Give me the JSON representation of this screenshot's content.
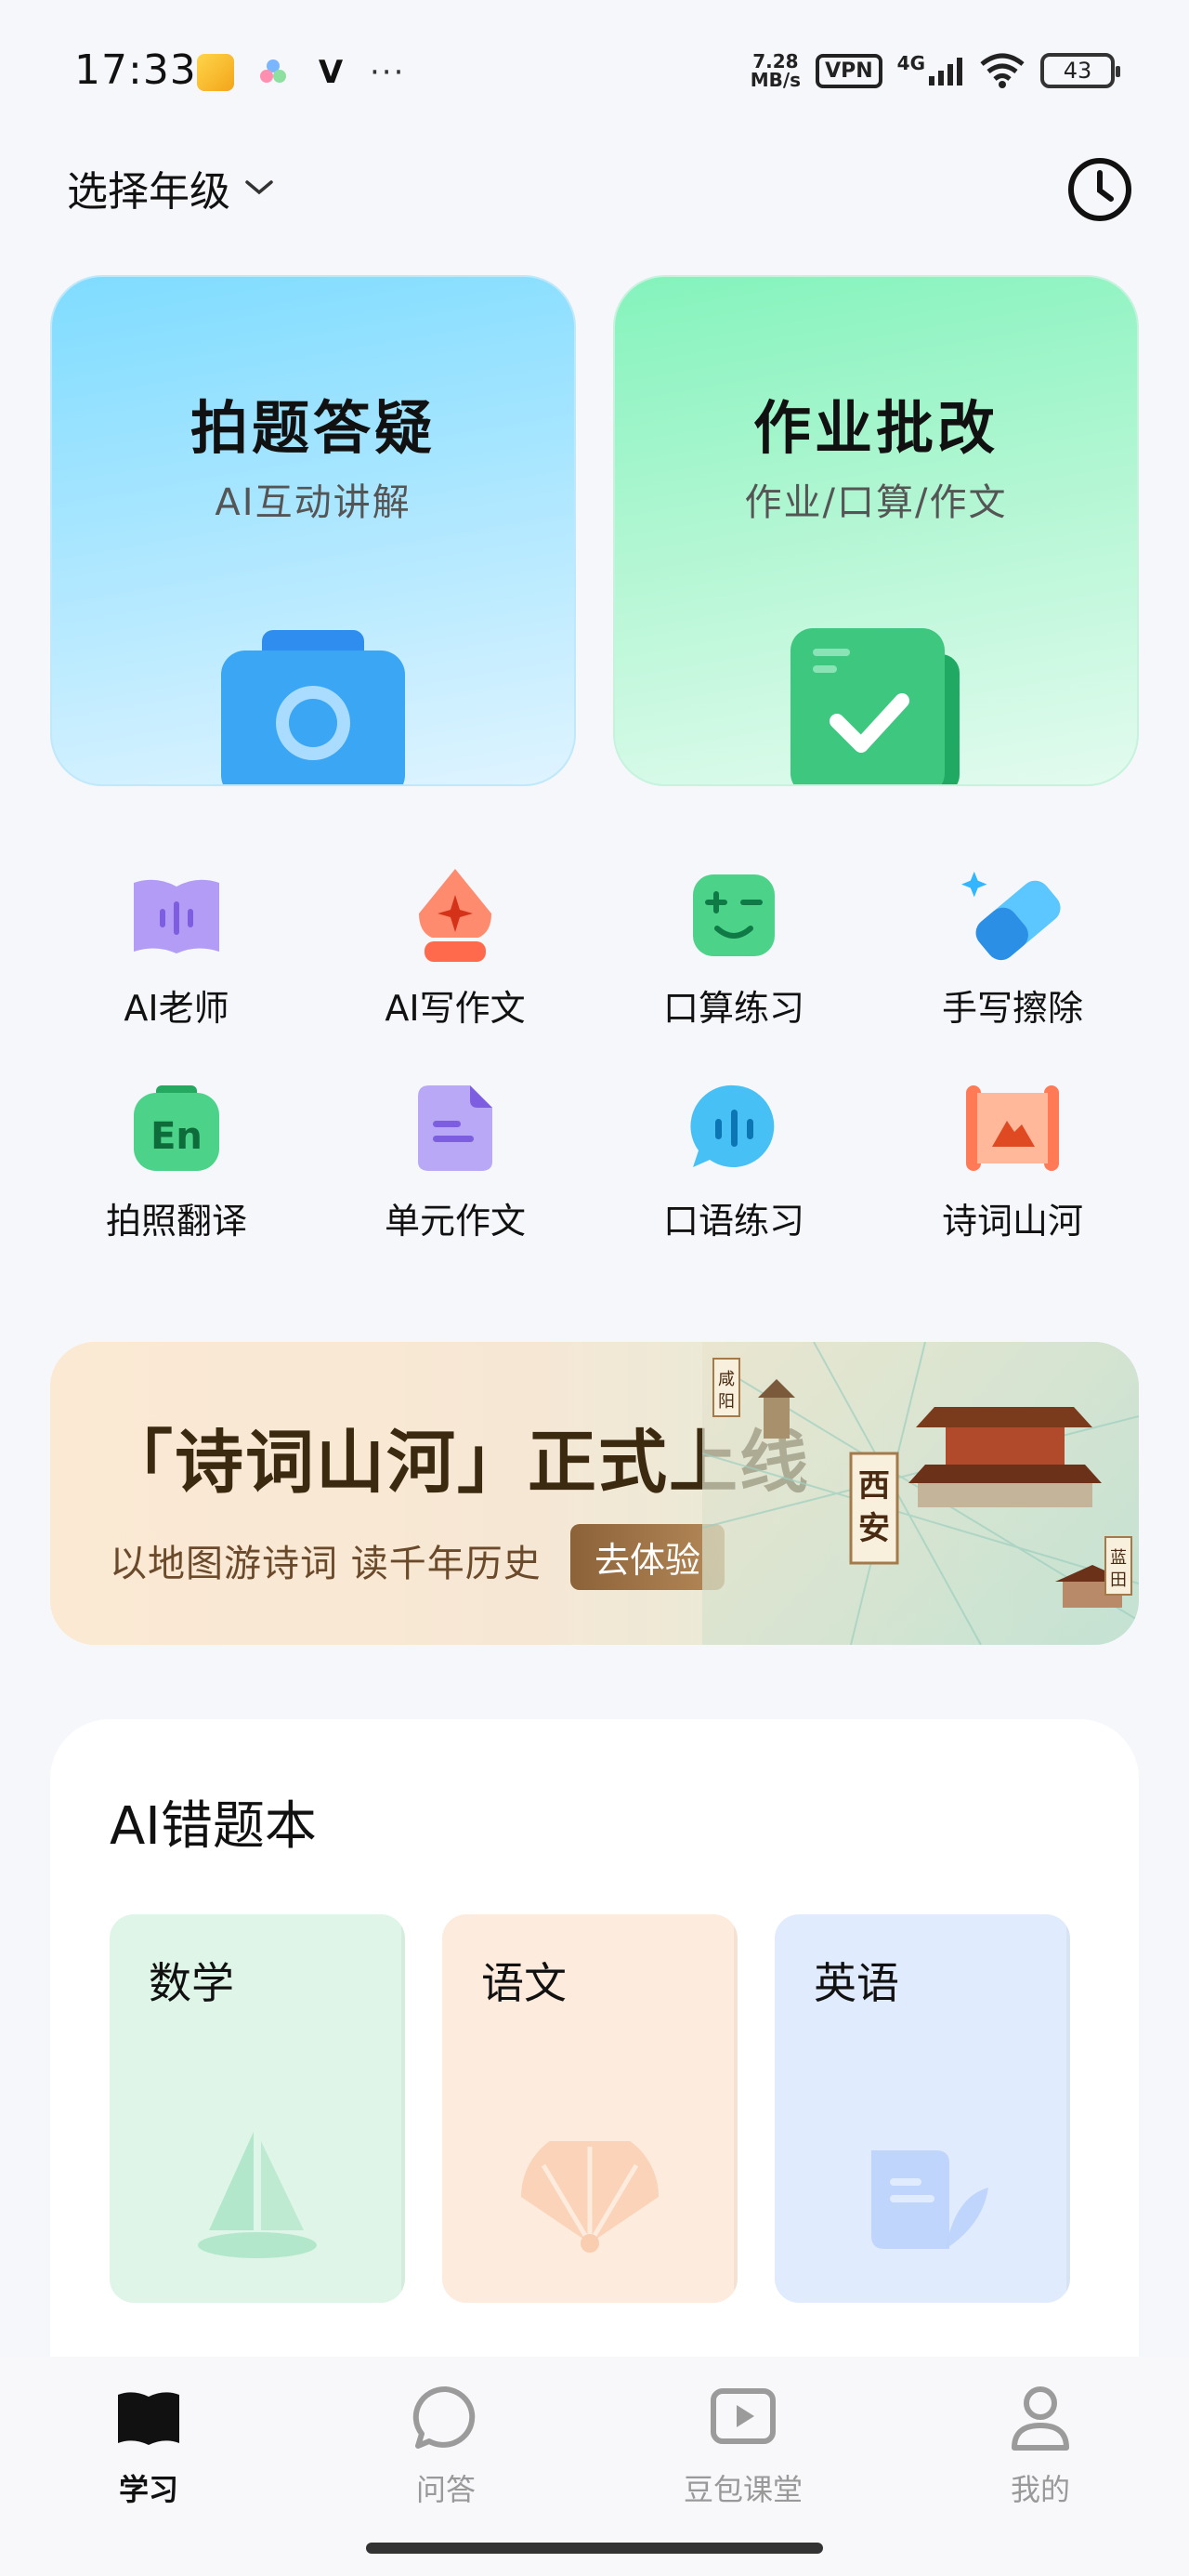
{
  "status_bar": {
    "time": "17:33",
    "net_speed_value": "7.28",
    "net_speed_unit": "MB/s",
    "vpn": "VPN",
    "network": "4G",
    "battery": "43"
  },
  "header": {
    "grade_select_label": "选择年级"
  },
  "big_cards": [
    {
      "title": "拍题答疑",
      "subtitle": "AI互动讲解"
    },
    {
      "title": "作业批改",
      "subtitle": "作业/口算/作文"
    }
  ],
  "tools": [
    {
      "label": "AI老师",
      "icon": "voice-book-icon"
    },
    {
      "label": "AI写作文",
      "icon": "pen-nib-icon"
    },
    {
      "label": "口算练习",
      "icon": "math-face-icon"
    },
    {
      "label": "手写擦除",
      "icon": "eraser-icon"
    },
    {
      "label": "拍照翻译",
      "icon": "translate-en-icon"
    },
    {
      "label": "单元作文",
      "icon": "document-icon"
    },
    {
      "label": "口语练习",
      "icon": "speech-bubble-icon"
    },
    {
      "label": "诗词山河",
      "icon": "scroll-icon"
    }
  ],
  "banner": {
    "title": "「诗词山河」正式上线",
    "subtitle": "以地图游诗词 读千年历史",
    "cta": "去体验",
    "map_label_main": "西安",
    "map_label_1": "咸阳",
    "map_label_2": "蓝田"
  },
  "wrong_book": {
    "title": "AI错题本",
    "subjects": [
      {
        "label": "数学",
        "icon": "sailboat-icon"
      },
      {
        "label": "语文",
        "icon": "fan-icon"
      },
      {
        "label": "英语",
        "icon": "scroll-quill-icon"
      }
    ]
  },
  "bottom_nav": [
    {
      "label": "学习",
      "icon": "book-icon",
      "active": true
    },
    {
      "label": "问答",
      "icon": "chat-bubble-icon",
      "active": false
    },
    {
      "label": "豆包课堂",
      "icon": "video-play-icon",
      "active": false
    },
    {
      "label": "我的",
      "icon": "user-icon",
      "active": false
    }
  ],
  "colors": {
    "photo_card": "#a9e6ff",
    "homework_card": "#b0f6d2",
    "math": "#def5e8",
    "chinese": "#fdebdd",
    "english": "#e0ecfd"
  }
}
